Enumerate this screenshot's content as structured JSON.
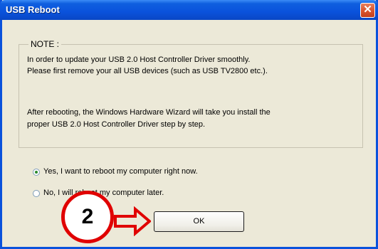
{
  "window": {
    "title": "USB Reboot",
    "close_glyph": "✕",
    "accent_color": "#0a52dc",
    "close_color": "#d9522c"
  },
  "note": {
    "legend": "NOTE :",
    "lines": [
      "In order to update your USB 2.0 Host Controller Driver smoothly.",
      "Please first remove your all USB devices (such as USB TV2800 etc.).",
      "After rebooting, the Windows Hardware Wizard will take you install the",
      "proper USB 2.0 Host Controller Driver step by step."
    ]
  },
  "options": [
    {
      "label": "Yes, I want to reboot my computer right now.",
      "selected": true
    },
    {
      "label": "No, I will reboot my computer later.",
      "selected": false
    }
  ],
  "ok_button": {
    "label": "OK"
  },
  "annotation": {
    "step_number": "2",
    "color": "#e00000",
    "arrow_icon": "right-arrow-icon"
  }
}
